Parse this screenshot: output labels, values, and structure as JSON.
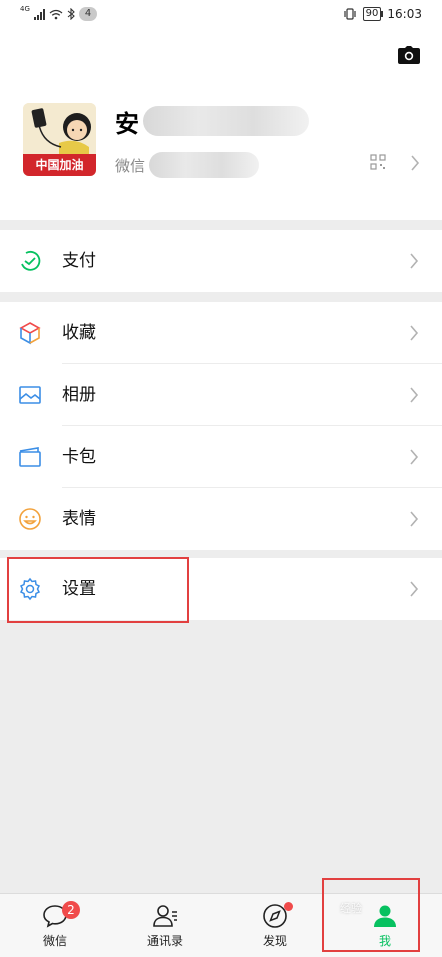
{
  "status_bar": {
    "network": "4G",
    "notification_count": "4",
    "battery_level": "90",
    "time": "16:03"
  },
  "profile": {
    "name_visible_char": "安",
    "wechat_id_prefix": "微信",
    "avatar_banner_text": "中国加油",
    "icons": [
      "camera-icon",
      "qr-code-icon",
      "chevron-right-icon"
    ]
  },
  "menu": {
    "pay": {
      "label": "支付",
      "icon": "pay-icon",
      "color": "#07c160"
    },
    "favorites": {
      "label": "收藏",
      "icon": "favorites-cube-icon"
    },
    "album": {
      "label": "相册",
      "icon": "album-icon",
      "color": "#3b8ee6"
    },
    "cards": {
      "label": "卡包",
      "icon": "card-wallet-icon",
      "color": "#3b8ee6"
    },
    "stickers": {
      "label": "表情",
      "icon": "sticker-smile-icon",
      "color": "#f2a23c"
    },
    "settings": {
      "label": "设置",
      "icon": "gear-icon",
      "color": "#3b8ee6"
    }
  },
  "tabbar": {
    "tabs": [
      {
        "label": "微信",
        "icon": "chat-bubble-icon",
        "badge": "2"
      },
      {
        "label": "通讯录",
        "icon": "contacts-icon"
      },
      {
        "label": "发现",
        "icon": "compass-icon",
        "dot": true
      },
      {
        "label": "我",
        "icon": "me-person-icon",
        "active": true
      }
    ]
  },
  "watermark_text": "经验",
  "colors": {
    "accent": "#07c160",
    "highlight": "#e24040",
    "badge": "#f04b4b"
  }
}
